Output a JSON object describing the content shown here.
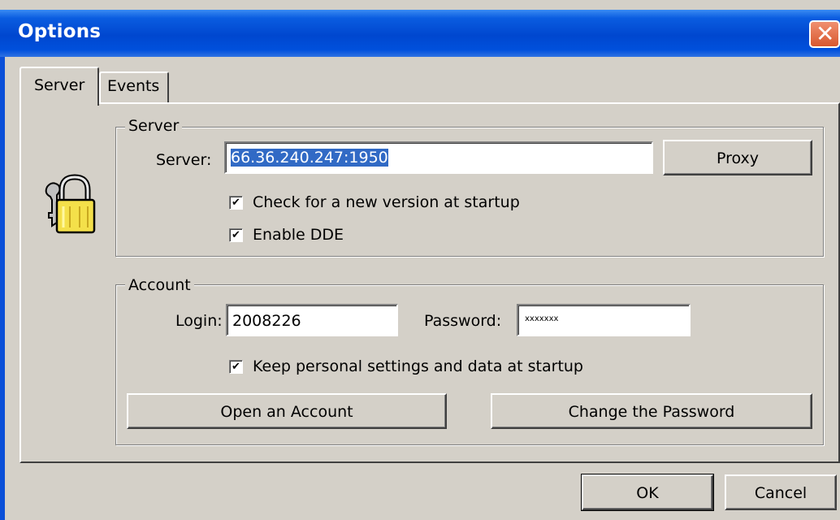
{
  "window": {
    "title": "Options",
    "close_glyph": "✕"
  },
  "tabs": [
    {
      "label": "Server",
      "selected": true
    },
    {
      "label": "Events",
      "selected": false
    }
  ],
  "server_group": {
    "title": "Server",
    "server_label": "Server:",
    "server_value": "66.36.240.247:1950",
    "proxy_label": "Proxy",
    "checkboxes": [
      {
        "label": "Check for a new version at startup",
        "checked": true
      },
      {
        "label": "Enable DDE",
        "checked": true
      }
    ]
  },
  "account_group": {
    "title": "Account",
    "login_label": "Login:",
    "login_value": "2008226",
    "password_label": "Password:",
    "password_value": "xxxxxxx",
    "keep_label": "Keep personal settings and data at startup",
    "keep_checked": true,
    "open_account_label": "Open an Account",
    "change_password_label": "Change the Password"
  },
  "footer": {
    "ok_label": "OK",
    "cancel_label": "Cancel"
  },
  "icons": {
    "lock": "lock-keys-icon",
    "check": "✔"
  },
  "colors": {
    "title_bar": "#0047cf",
    "selection": "#316ac5",
    "face": "#d4d0c8"
  }
}
